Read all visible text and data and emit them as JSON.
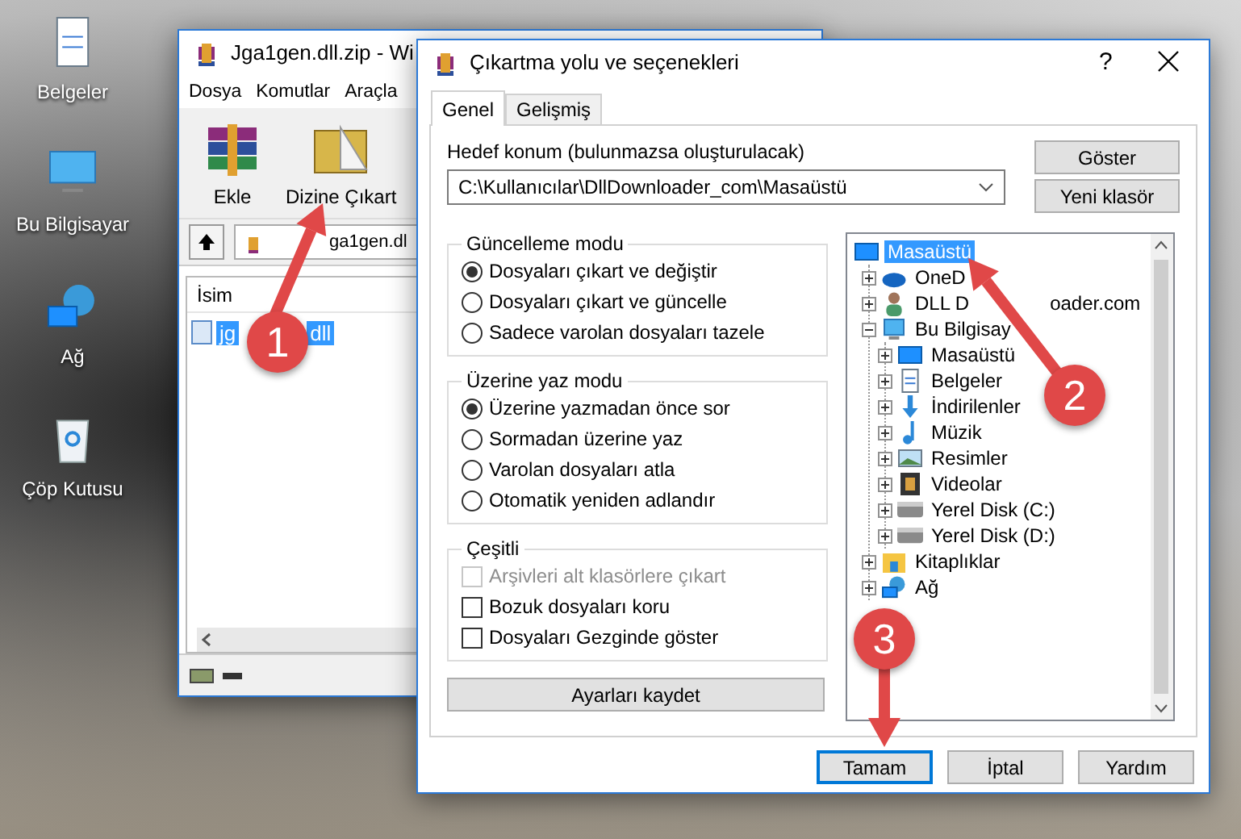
{
  "desktop_icons": [
    {
      "label": "Belgeler",
      "kind": "documents"
    },
    {
      "label": "Bu Bilgisayar",
      "kind": "computer"
    },
    {
      "label": "Ağ",
      "kind": "network"
    },
    {
      "label": "Çöp Kutusu",
      "kind": "recycle"
    }
  ],
  "archiver": {
    "title": "Jga1gen.dll.zip - Wi",
    "menu": [
      "Dosya",
      "Komutlar",
      "Araçla"
    ],
    "toolbar": [
      {
        "label": "Ekle",
        "kind": "add"
      },
      {
        "label": "Dizine Çıkart",
        "kind": "extract"
      }
    ],
    "path": "ga1gen.dl",
    "columns": [
      "İsim"
    ],
    "files": [
      {
        "name": "jg",
        "name_end": "dll",
        "selected": true
      }
    ]
  },
  "dialog": {
    "title": "Çıkartma yolu ve seçenekleri",
    "help": "?",
    "tabs": [
      {
        "label": "Genel",
        "selected": true
      },
      {
        "label": "Gelişmiş",
        "selected": false
      }
    ],
    "destination_label": "Hedef konum (bulunmazsa oluşturulacak)",
    "destination": "C:\\Kullanıcılar\\DllDownloader_com\\Masaüstü",
    "side_buttons": [
      "Göster",
      "Yeni klasör"
    ],
    "groups": [
      {
        "title": "Güncelleme modu",
        "kind": "radio",
        "options": [
          {
            "label": "Dosyaları çıkart ve değiştir",
            "selected": true
          },
          {
            "label": "Dosyaları çıkart ve güncelle",
            "selected": false
          },
          {
            "label": "Sadece varolan dosyaları tazele",
            "selected": false
          }
        ]
      },
      {
        "title": "Üzerine yaz modu",
        "kind": "radio",
        "options": [
          {
            "label": "Üzerine yazmadan önce sor",
            "selected": true
          },
          {
            "label": "Sormadan üzerine yaz",
            "selected": false
          },
          {
            "label": "Varolan dosyaları atla",
            "selected": false
          },
          {
            "label": "Otomatik yeniden adlandır",
            "selected": false
          }
        ]
      },
      {
        "title": "Çeşitli",
        "kind": "checkbox",
        "options": [
          {
            "label": "Arşivleri alt klasörlere çıkart",
            "checked": false,
            "disabled": true
          },
          {
            "label": "Bozuk dosyaları koru",
            "checked": false,
            "disabled": false
          },
          {
            "label": "Dosyaları Gezginde göster",
            "checked": false,
            "disabled": false
          }
        ]
      }
    ],
    "save_button": "Ayarları kaydet",
    "tree": [
      {
        "label": "Masaüstü",
        "kind": "desktop",
        "selected": true,
        "children": [
          {
            "label": "OneD",
            "kind": "cloud",
            "selected": false,
            "expanded": false
          },
          {
            "label": "DLL D",
            "label_end": "oader.com",
            "kind": "user",
            "selected": false,
            "expanded": false
          },
          {
            "label": "Bu Bilgisay",
            "kind": "computer",
            "selected": false,
            "expanded": true,
            "children": [
              {
                "label": "Masaüstü",
                "kind": "desktop",
                "selected": false,
                "expanded": false
              },
              {
                "label": "Belgeler",
                "kind": "documents",
                "selected": false,
                "expanded": false
              },
              {
                "label": "İndirilenler",
                "kind": "download",
                "selected": false,
                "expanded": false
              },
              {
                "label": "Müzik",
                "kind": "music",
                "selected": false,
                "expanded": false
              },
              {
                "label": "Resimler",
                "kind": "pictures",
                "selected": false,
                "expanded": false
              },
              {
                "label": "Videolar",
                "kind": "video",
                "selected": false,
                "expanded": false
              },
              {
                "label": "Yerel Disk (C:)",
                "kind": "drive",
                "selected": false,
                "expanded": false
              },
              {
                "label": "Yerel Disk (D:)",
                "kind": "drive",
                "selected": false,
                "expanded": false
              }
            ]
          },
          {
            "label": "Kitaplıklar",
            "kind": "library",
            "selected": false,
            "expanded": false
          },
          {
            "label": "Ağ",
            "kind": "network",
            "selected": false,
            "expanded": false
          }
        ]
      }
    ],
    "buttons": [
      {
        "label": "Tamam",
        "focused": true
      },
      {
        "label": "İptal",
        "focused": false
      },
      {
        "label": "Yardım",
        "focused": false
      }
    ]
  },
  "annotations": [
    {
      "number": "1"
    },
    {
      "number": "2"
    },
    {
      "number": "3"
    }
  ]
}
